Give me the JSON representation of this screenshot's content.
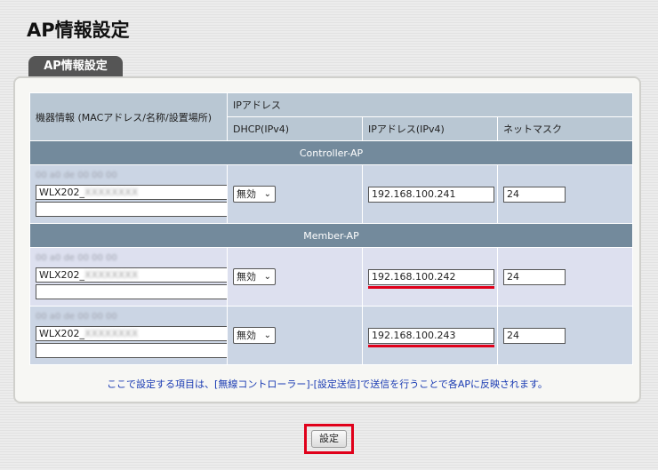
{
  "page_title": "AP情報設定",
  "tab_label": "AP情報設定",
  "headers": {
    "device_info": "機器情報 (MACアドレス/名称/設置場所)",
    "ip_group": "IPアドレス",
    "dhcp": "DHCP(IPv4)",
    "ip": "IPアドレス(IPv4)",
    "netmask": "ネットマスク"
  },
  "sections": {
    "controller": "Controller-AP",
    "member": "Member-AP"
  },
  "rows": [
    {
      "mac": "00 a0 de 00 00 00",
      "name_prefix": "WLX202_",
      "name_blur": "XXXXXXXX",
      "location": "",
      "dhcp": "無効",
      "ip": "192.168.100.241",
      "mask": "24"
    },
    {
      "mac": "00 a0 de 00 00 00",
      "name_prefix": "WLX202_",
      "name_blur": "XXXXXXXX",
      "location": "",
      "dhcp": "無効",
      "ip": "192.168.100.242",
      "mask": "24"
    },
    {
      "mac": "00 a0 de 00 00 00",
      "name_prefix": "WLX202_",
      "name_blur": "XXXXXXXX",
      "location": "",
      "dhcp": "無効",
      "ip": "192.168.100.243",
      "mask": "24"
    }
  ],
  "note": "ここで設定する項目は、[無線コントローラー]-[設定送信]で送信を行うことで各APに反映されます。",
  "submit_label": "設定",
  "colors": {
    "highlight": "#e0001a",
    "section_bg": "#738a9c",
    "header_bg": "#b9c7d3",
    "note": "#1a3bb3"
  }
}
